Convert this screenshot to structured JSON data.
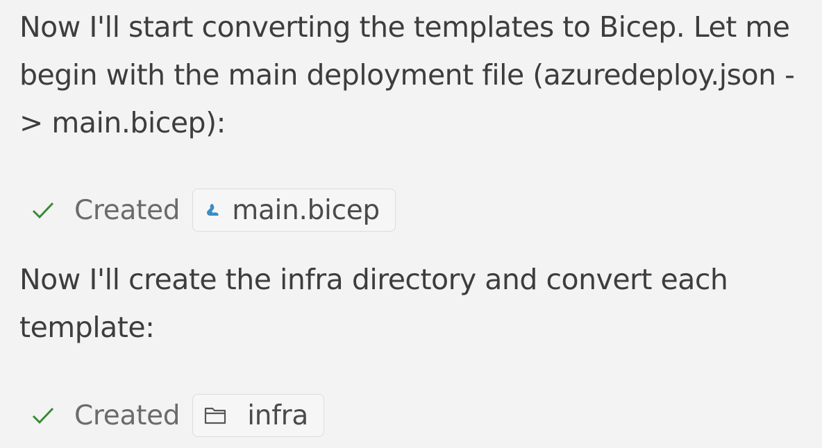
{
  "messages": {
    "paragraph_1": "Now I'll start converting the templates to Bicep. Let me begin with the main deployment file (azuredeploy.json -> main.bicep):",
    "paragraph_2": "Now I'll create the infra directory and convert each template:"
  },
  "actions": [
    {
      "status_icon": "check-icon",
      "label": "Created",
      "file_icon": "bicep-file-icon",
      "file_name": "main.bicep"
    },
    {
      "status_icon": "check-icon",
      "label": "Created",
      "file_icon": "folder-icon",
      "file_name": "infra"
    }
  ],
  "colors": {
    "background": "#f3f3f3",
    "text": "#3d3d3d",
    "check": "#388a34",
    "bicep_icon": "#3b8cc6"
  }
}
